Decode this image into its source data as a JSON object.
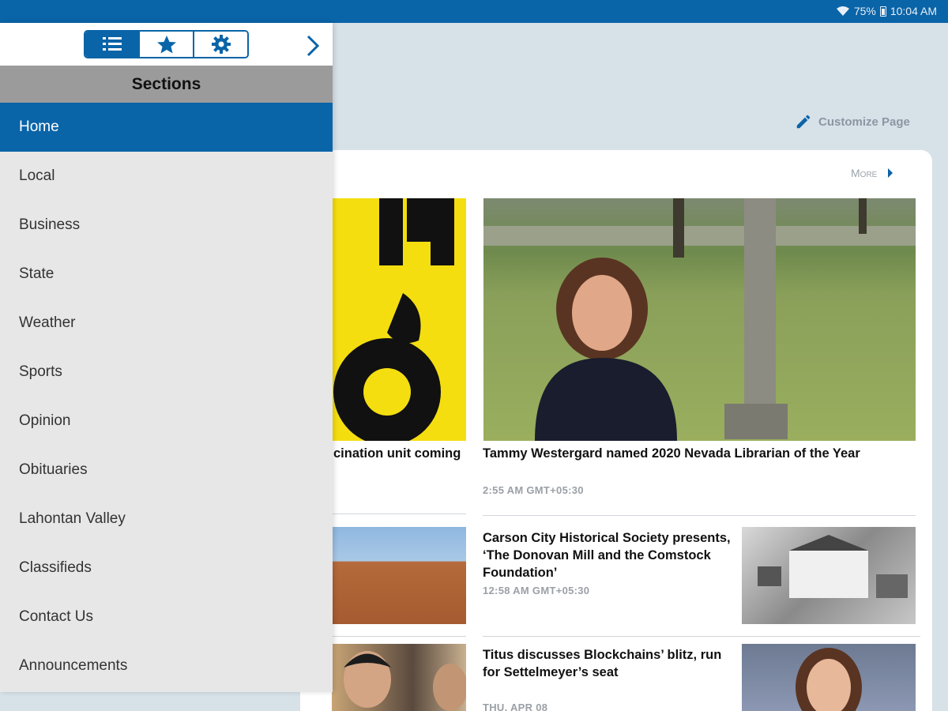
{
  "status_bar": {
    "battery": "75%",
    "time": "10:04 AM",
    "wifi_icon": "wifi-icon",
    "battery_icon": "battery-icon"
  },
  "drawer": {
    "tabs": [
      {
        "icon": "list-icon",
        "active": true
      },
      {
        "icon": "star-icon",
        "active": false
      },
      {
        "icon": "gear-icon",
        "active": false
      }
    ],
    "close_icon": "chevron-right-icon",
    "header": "Sections",
    "items": [
      {
        "label": "Home",
        "active": true
      },
      {
        "label": "Local"
      },
      {
        "label": "Business"
      },
      {
        "label": "State"
      },
      {
        "label": "Weather"
      },
      {
        "label": "Sports"
      },
      {
        "label": "Opinion"
      },
      {
        "label": "Obituaries"
      },
      {
        "label": "Lahontan Valley"
      },
      {
        "label": "Classifieds"
      },
      {
        "label": "Contact Us"
      },
      {
        "label": "Announcements"
      }
    ]
  },
  "main": {
    "customize_label": "Customize Page",
    "more_label": "More",
    "stories": [
      {
        "headline": "cination unit coming",
        "time": ""
      },
      {
        "headline": "Tammy Westergard named 2020 Nevada Librarian of the Year",
        "time": "2:55 AM GMT+05:30"
      },
      {
        "headline": "Carson City Historical Society presents, ‘The Donovan Mill and the Comstock Foundation’",
        "time": "12:58 AM GMT+05:30"
      },
      {
        "headline": "Titus discusses Blockchains’ blitz, run for Settelmeyer’s seat",
        "time": "THU, APR 08"
      }
    ]
  },
  "colors": {
    "brand_blue": "#0a64a8",
    "drawer_bg": "#e7e7e7",
    "header_gray": "#9b9b9b",
    "page_bg": "#d7e1e8"
  }
}
